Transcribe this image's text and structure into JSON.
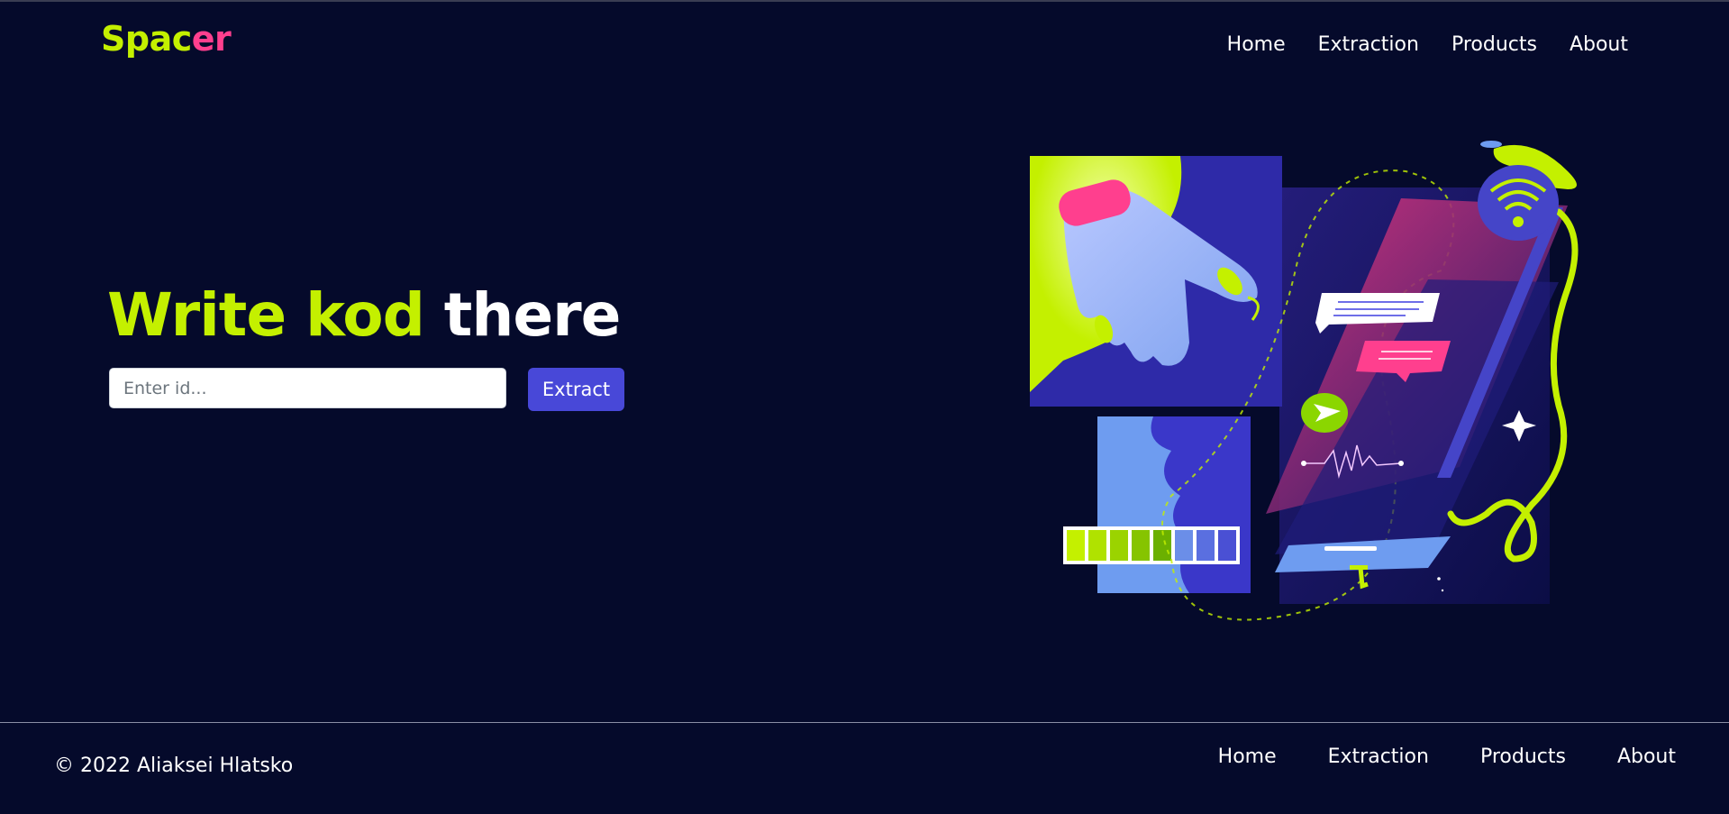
{
  "brand": {
    "logo_part1": "Spac",
    "logo_part2": "er",
    "accent_green": "#c4f000",
    "accent_pink": "#ff3f8e",
    "background": "#050a2b"
  },
  "header": {
    "nav": [
      "Home",
      "Extraction",
      "Products",
      "About"
    ]
  },
  "hero": {
    "headline_green": "Write kod",
    "headline_white": "there",
    "input_placeholder": "Enter id...",
    "input_value": "",
    "button_label": "Extract",
    "button_color": "#4848d8"
  },
  "footer": {
    "copyright": "© 2022 Aliaksei Hlatsko",
    "nav": [
      "Home",
      "Extraction",
      "Products",
      "About"
    ]
  },
  "icons": [
    "hand-pointing-illustration",
    "smartphone-illustration",
    "wifi-icon",
    "send-icon",
    "sparkle-icon",
    "progress-bar-graphic"
  ]
}
